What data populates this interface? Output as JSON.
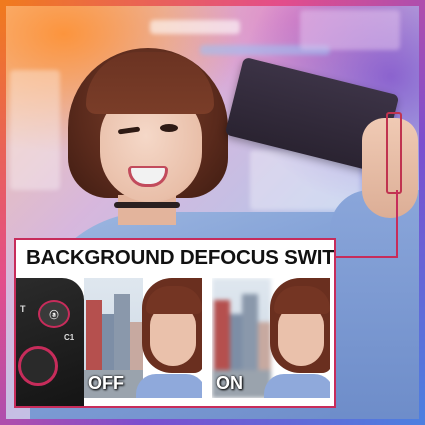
{
  "callout": {
    "title": "BACKGROUND DEFOCUS SWITCH"
  },
  "remote": {
    "t_label": "T",
    "switch_label": "ⓐ",
    "c1_label": "C1"
  },
  "comparison": {
    "off_label": "OFF",
    "on_label": "ON"
  },
  "colors": {
    "accent": "#c72c5b",
    "frame_gradient": [
      "#f07a1e",
      "#e34d8b",
      "#7b4fcf",
      "#4d7fe0"
    ]
  }
}
